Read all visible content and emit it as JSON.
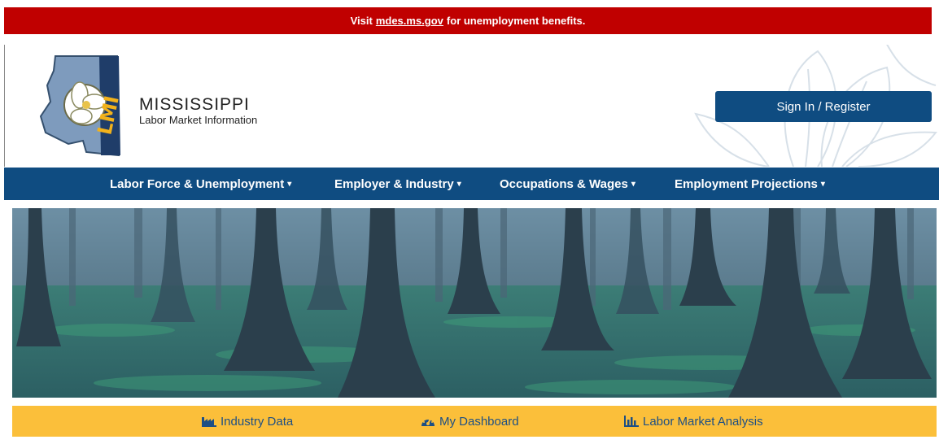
{
  "alert": {
    "prefix": "Visit",
    "link": "mdes.ms.gov",
    "suffix": "for unemployment benefits."
  },
  "brand": {
    "title": "MISSISSIPPI",
    "subtitle": "Labor Market Information",
    "logo_text": "LMI"
  },
  "header": {
    "signin_label": "Sign In / Register"
  },
  "nav": {
    "items": [
      {
        "label": "Labor Force & Unemployment"
      },
      {
        "label": "Employer & Industry"
      },
      {
        "label": "Occupations & Wages"
      },
      {
        "label": "Employment Projections"
      }
    ]
  },
  "quick_links": [
    {
      "label": "Industry Data",
      "icon": "industry-icon"
    },
    {
      "label": "My Dashboard",
      "icon": "dashboard-icon"
    },
    {
      "label": "Labor Market Analysis",
      "icon": "bar-chart-icon"
    }
  ],
  "colors": {
    "alert": "#c00000",
    "primary": "#0f4c81",
    "quick_bar": "#fbbf3a",
    "link": "#1d4f84"
  }
}
